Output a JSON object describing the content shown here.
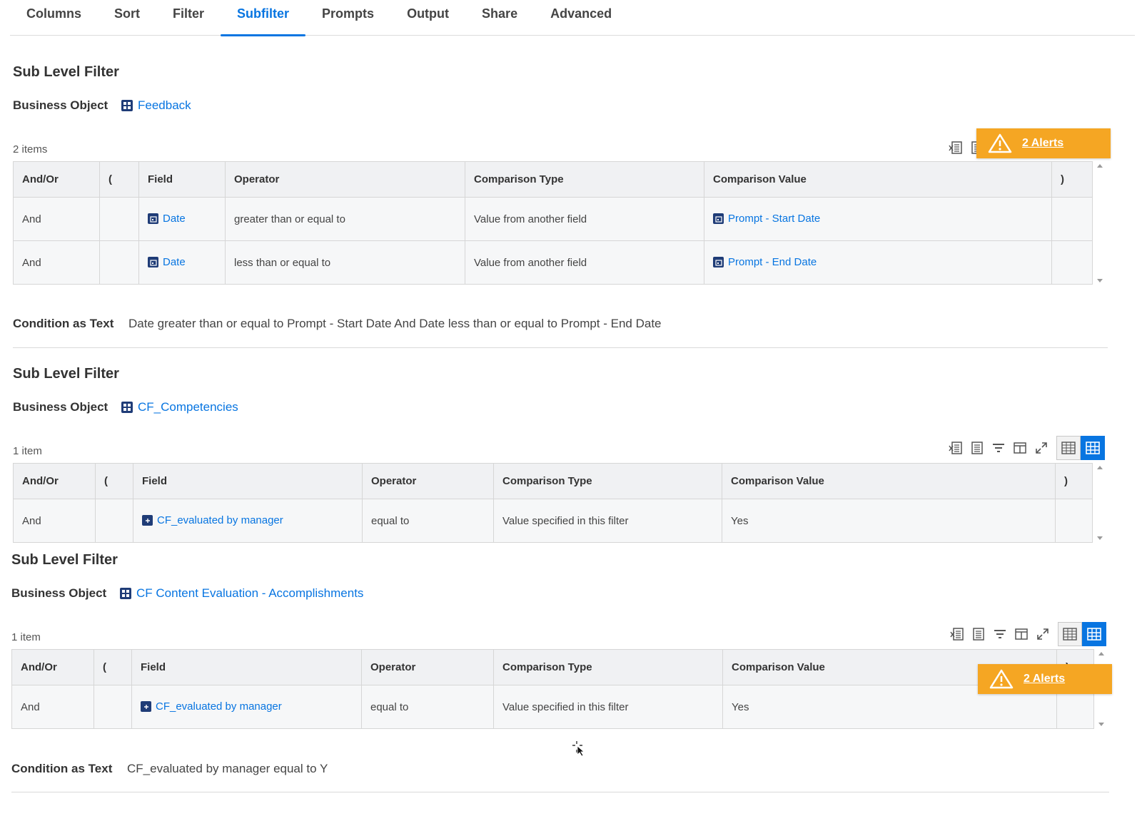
{
  "tabs": [
    "Columns",
    "Sort",
    "Filter",
    "Subfilter",
    "Prompts",
    "Output",
    "Share",
    "Advanced"
  ],
  "active_tab": "Subfilter",
  "common": {
    "section_title": "Sub Level Filter",
    "business_object_label": "Business Object",
    "condition_label": "Condition as Text",
    "columns": [
      "And/Or",
      "(",
      "Field",
      "Operator",
      "Comparison Type",
      "Comparison Value",
      ")"
    ],
    "alerts_label": "2 Alerts"
  },
  "filters": [
    {
      "business_object": "Feedback",
      "count_text": "2 items",
      "rows": [
        {
          "and_or": "And",
          "open_paren": "",
          "field": "Date",
          "operator": "greater than or equal to",
          "comparison_type": "Value from another field",
          "comparison_value": "Prompt - Start Date",
          "close_paren": ""
        },
        {
          "and_or": "And",
          "open_paren": "",
          "field": "Date",
          "operator": "less than or equal to",
          "comparison_type": "Value from another field",
          "comparison_value": "Prompt - End Date",
          "close_paren": ""
        }
      ],
      "condition_text": "Date greater than or equal to Prompt - Start Date And Date less than or equal to Prompt - End Date"
    },
    {
      "business_object": "CF_Competencies",
      "count_text": "1 item",
      "rows": [
        {
          "and_or": "And",
          "open_paren": "",
          "field": "CF_evaluated by manager",
          "operator": "equal to",
          "comparison_type": "Value specified in this filter",
          "comparison_value": "Yes",
          "close_paren": ""
        }
      ]
    },
    {
      "business_object": "CF Content Evaluation - Accomplishments",
      "count_text": "1 item",
      "rows": [
        {
          "and_or": "And",
          "open_paren": "",
          "field": "CF_evaluated by manager",
          "operator": "equal to",
          "comparison_type": "Value specified in this filter",
          "comparison_value": "Yes",
          "close_paren": ""
        }
      ],
      "condition_text": "CF_evaluated by manager equal to Y"
    }
  ],
  "colors": {
    "accent": "#0875e1",
    "alert": "#f5a623",
    "icon_bg": "#1f3c77"
  }
}
